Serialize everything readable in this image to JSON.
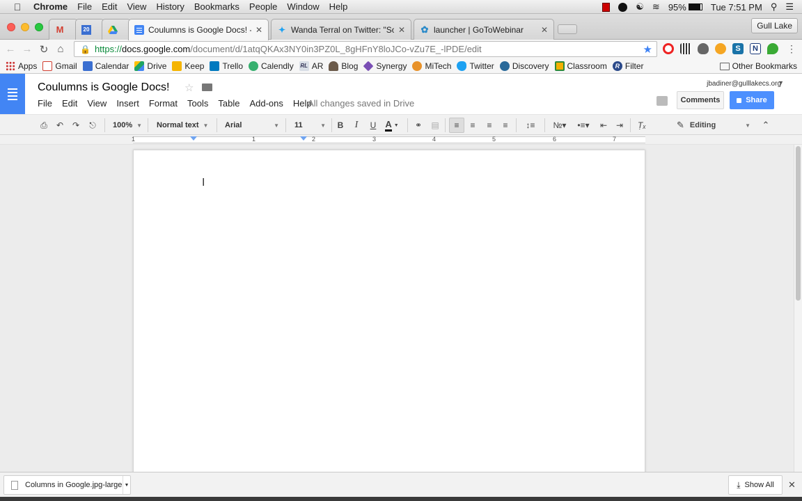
{
  "mac_menu": {
    "app": "Chrome",
    "items": [
      "File",
      "Edit",
      "View",
      "History",
      "Bookmarks",
      "People",
      "Window",
      "Help"
    ],
    "battery": "95%",
    "clock": "Tue 7:51 PM"
  },
  "tabs": {
    "items": [
      {
        "title": "",
        "icon": "gmail-icon"
      },
      {
        "title": "",
        "icon": "calendar-icon",
        "badge": "20"
      },
      {
        "title": "",
        "icon": "drive-icon"
      },
      {
        "title": "Coulumns is Google Docs! - G",
        "icon": "docs-icon",
        "active": true
      },
      {
        "title": "Wanda Terral on Twitter: \"So e",
        "icon": "twitter-icon"
      },
      {
        "title": "launcher | GoToWebinar",
        "icon": "gotowebinar-icon"
      }
    ],
    "profile": "Gull Lake"
  },
  "omnibox": {
    "scheme": "https://",
    "domain": "docs.google.com",
    "path": "/document/d/1atqQKAx3NY0in3PZ0L_8gHFnY8loJCo-vZu7E_-lPDE/edit"
  },
  "bookmarks": {
    "items": [
      {
        "label": "Apps",
        "color": "#c33"
      },
      {
        "label": "Gmail",
        "color": "#d23f31"
      },
      {
        "label": "Calendar",
        "color": "#3b6fd1"
      },
      {
        "label": "Drive",
        "color": "#1fa463"
      },
      {
        "label": "Keep",
        "color": "#f5b400"
      },
      {
        "label": "Trello",
        "color": "#0079bf"
      },
      {
        "label": "Calendly",
        "color": "#37b06f"
      },
      {
        "label": "AR",
        "color": "#8aa0b8"
      },
      {
        "label": "Blog",
        "color": "#555"
      },
      {
        "label": "Synergy",
        "color": "#7a4fb5"
      },
      {
        "label": "MiTech",
        "color": "#e8922a"
      },
      {
        "label": "Twitter",
        "color": "#1da1f2"
      },
      {
        "label": "Discovery",
        "color": "#2a6a9a"
      },
      {
        "label": "Classroom",
        "color": "#f3b000"
      },
      {
        "label": "Filter",
        "color": "#2b4a8a"
      }
    ],
    "other": "Other Bookmarks"
  },
  "doc": {
    "title": "Coulumns is Google Docs!",
    "menus": [
      "File",
      "Edit",
      "View",
      "Insert",
      "Format",
      "Tools",
      "Table",
      "Add-ons",
      "Help"
    ],
    "saved_status": "All changes saved in Drive",
    "user_email": "jbadiner@gulllakecs.org",
    "comments_label": "Comments",
    "share_label": "Share"
  },
  "format_toolbar": {
    "zoom": "100%",
    "style": "Normal text",
    "font": "Arial",
    "size": "11",
    "mode": "Editing"
  },
  "ruler": [
    "1",
    "1",
    "2",
    "3",
    "4",
    "5",
    "6",
    "7"
  ],
  "downloads": {
    "file": "Columns in Google.jpg-large",
    "show_all": "Show All"
  },
  "colors": {
    "docs_blue": "#4285f4",
    "share_blue": "#4d90fe"
  }
}
